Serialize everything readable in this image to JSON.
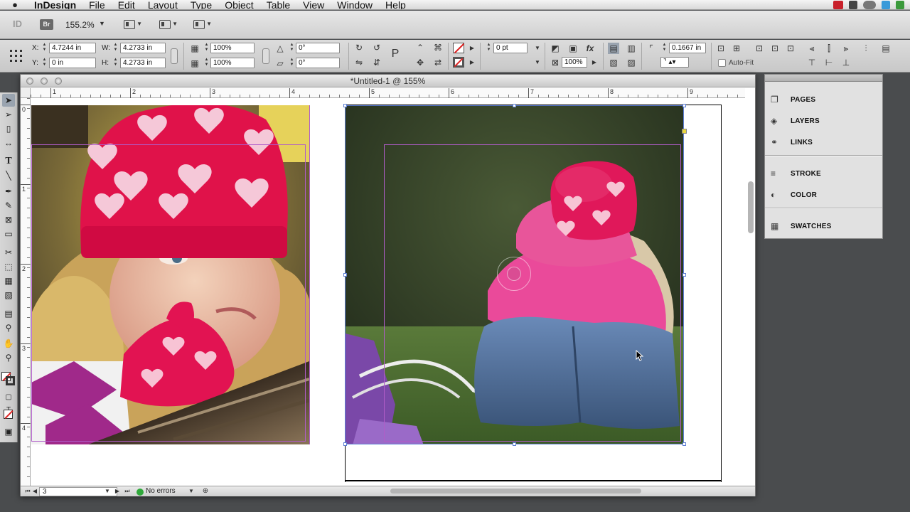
{
  "menubar": {
    "app": "InDesign",
    "items": [
      "File",
      "Edit",
      "Layout",
      "Type",
      "Object",
      "Table",
      "View",
      "Window",
      "Help"
    ]
  },
  "appbar": {
    "logo": "ID",
    "bridge": "Br",
    "zoom": "155.2%"
  },
  "control": {
    "x_label": "X:",
    "x_value": "4.7244 in",
    "y_label": "Y:",
    "y_value": "0 in",
    "w_label": "W:",
    "w_value": "4.2733 in",
    "h_label": "H:",
    "h_value": "4.2733 in",
    "scale_x": "100%",
    "scale_y": "100%",
    "rotate": "0°",
    "shear": "0°",
    "stroke_weight": "0 pt",
    "opacity": "100%",
    "offset": "0.1667 in",
    "autofit_label": "Auto-Fit"
  },
  "document": {
    "title": "*Untitled-1 @ 155%",
    "ruler_h": [
      "1",
      "2",
      "3",
      "4",
      "5",
      "6",
      "7",
      "8",
      "9"
    ],
    "ruler_v": [
      "0",
      "1",
      "2",
      "3",
      "4"
    ],
    "page": "3",
    "preflight": "No errors"
  },
  "panels": {
    "group1": [
      "PAGES",
      "LAYERS",
      "LINKS"
    ],
    "group2": [
      "STROKE",
      "COLOR"
    ],
    "group3": [
      "SWATCHES"
    ]
  },
  "icons": {
    "apple": "apple-icon",
    "pages": "pages-icon",
    "layers": "layers-icon",
    "links": "links-icon",
    "stroke": "stroke-icon",
    "color": "color-icon",
    "swatches": "swatches-icon"
  }
}
